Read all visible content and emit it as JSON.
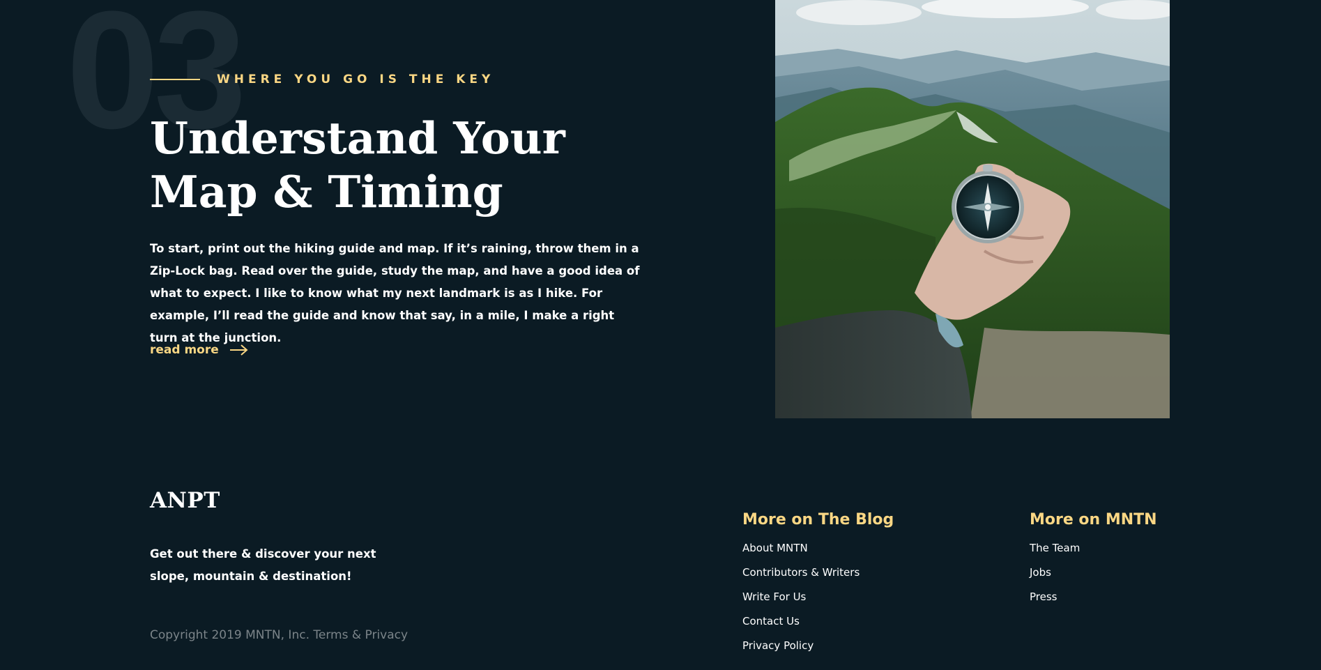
{
  "section": {
    "number": "03",
    "eyebrow": "WHERE YOU GO IS THE KEY",
    "headline_line1": "Understand Your",
    "headline_line2": "Map & Timing",
    "body": "To start, print out the hiking guide and map. If it’s raining, throw them in a Zip-Lock bag. Read over the guide, study the map, and have a good idea of what to expect. I like to know what my next landmark is as I hike. For example, I’ll read the guide and know that say, in a mile, I make a right turn at the junction.",
    "read_more": "read more",
    "read_more_icon": "arrow-right-icon"
  },
  "footer": {
    "brand": "ANPT",
    "tagline": "Get out there & discover your next slope, mountain & destination!",
    "copyright": "Copyright 2019 MNTN, Inc. Terms & Privacy",
    "columns": [
      {
        "title": "More on The Blog",
        "links": [
          "About MNTN",
          "Contributors & Writers",
          "Write For Us",
          "Contact Us",
          "Privacy Policy"
        ]
      },
      {
        "title": "More on MNTN",
        "links": [
          "The Team",
          "Jobs",
          "Press"
        ]
      }
    ]
  },
  "colors": {
    "background": "#0b1b24",
    "accent": "#fbd784",
    "text": "#ffffff",
    "muted": "#7b8489"
  }
}
